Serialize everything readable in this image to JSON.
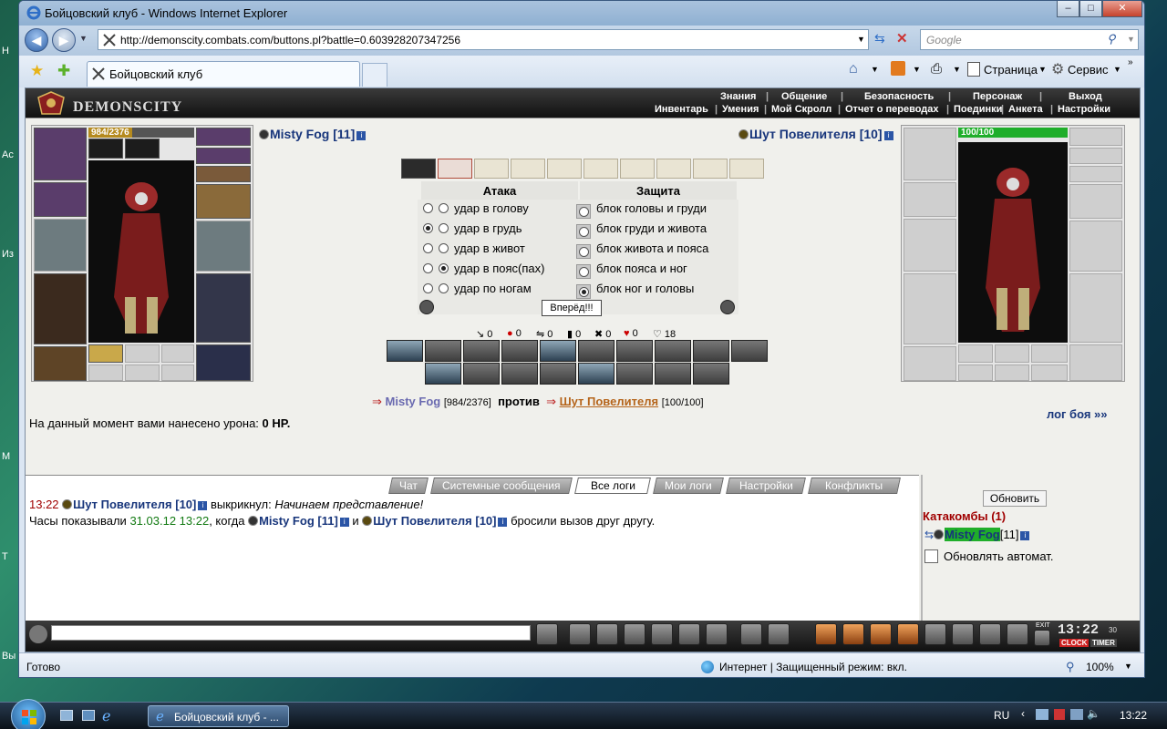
{
  "window": {
    "title": "Бойцовский клуб - Windows Internet Explorer"
  },
  "nav": {
    "url": "http://demonscity.combats.com/buttons.pl?battle=0.603928207347256",
    "search_placeholder": "Google"
  },
  "tabs": {
    "active_label": "Бойцовский клуб"
  },
  "commands": {
    "page": "Страница",
    "tools": "Сервис"
  },
  "game": {
    "logo": "DEMONSCITY",
    "menu_top": [
      "Знания",
      "Общение",
      "Безопасность",
      "Персонаж",
      "Выход"
    ],
    "menu_bottom": [
      "Инвентарь",
      "Умения",
      "Мой Скролл",
      "Отчет о переводах",
      "Поединки",
      "Анкета",
      "Настройки"
    ]
  },
  "player": {
    "name": "Misty Fog [11]",
    "hp_text": "984/2376",
    "hp_fraction": 0.414
  },
  "opponent": {
    "name": "Шут Повелителя [10]",
    "hp_text": "100/100",
    "hp_fraction": 1.0
  },
  "fight": {
    "attack_header": "Атака",
    "defense_header": "Защита",
    "attacks": [
      {
        "label": "удар в голову",
        "selected": false
      },
      {
        "label": "удар в грудь",
        "selected": true
      },
      {
        "label": "удар в живот",
        "selected": false
      },
      {
        "label": "удар в пояс(пах)",
        "selected": true
      },
      {
        "label": "удар по ногам",
        "selected": false
      }
    ],
    "defenses": [
      {
        "label": "блок головы и груди",
        "selected": false
      },
      {
        "label": "блок груди и живота",
        "selected": false
      },
      {
        "label": "блок живота и пояса",
        "selected": false
      },
      {
        "label": "блок пояса и ног",
        "selected": false
      },
      {
        "label": "блок ног и головы",
        "selected": true
      }
    ],
    "go_button": "Вперёд!!!",
    "stats": [
      "0",
      "0",
      "0",
      "0",
      "0",
      "0",
      "18"
    ],
    "vs": {
      "player": "Misty Fog",
      "player_hp": "[984/2376]",
      "word": "против",
      "opponent": "Шут Повелителя",
      "opponent_hp": "[100/100]"
    },
    "damage_prefix": "На данный момент вами нанесено урона:",
    "damage_value": "0 HP.",
    "log_link": "лог боя »»"
  },
  "chat": {
    "tabs": [
      "Чат",
      "Системные сообщения",
      "Все логи",
      "Мои логи",
      "Настройки",
      "Конфликты"
    ],
    "active_tab": "Все логи",
    "line1": {
      "time": "13:22",
      "name": "Шут Повелителя [10]",
      "verb": "выкрикнул:",
      "text": "Начинаем представление!"
    },
    "line2": {
      "prefix": "Часы показывали",
      "date": "31.03.12 13:22",
      "when": ", когда",
      "name1": "Misty Fog [11]",
      "and": "и",
      "name2": "Шут Повелителя [10]",
      "suffix": "бросили вызов друг другу."
    }
  },
  "side": {
    "refresh": "Обновить",
    "location": "Катакомбы (1)",
    "user": "Misty Fog",
    "user_level": "[11]",
    "auto": "Обновлять автомат."
  },
  "toolbar": {
    "clock": "13:22",
    "clock_sec": "30",
    "clock_label": "CLOCK",
    "timer_label": "TIMER",
    "exit": "EXIT"
  },
  "status": {
    "left": "Готово",
    "zone": "Интернет | Защищенный режим: вкл.",
    "zoom": "100%"
  },
  "taskbar": {
    "ie": "Бойцовский клуб - ...",
    "lang": "RU",
    "time": "13:22"
  },
  "desktop": {
    "labels": [
      "Н",
      "Ас",
      "Из",
      "М",
      "Т",
      "Вы"
    ]
  },
  "colors": {
    "accent": "#17357b",
    "hp_green": "#1fae2a",
    "hp_gold": "#b58a1e",
    "time_red": "#a00000",
    "date_green": "#127a12"
  }
}
